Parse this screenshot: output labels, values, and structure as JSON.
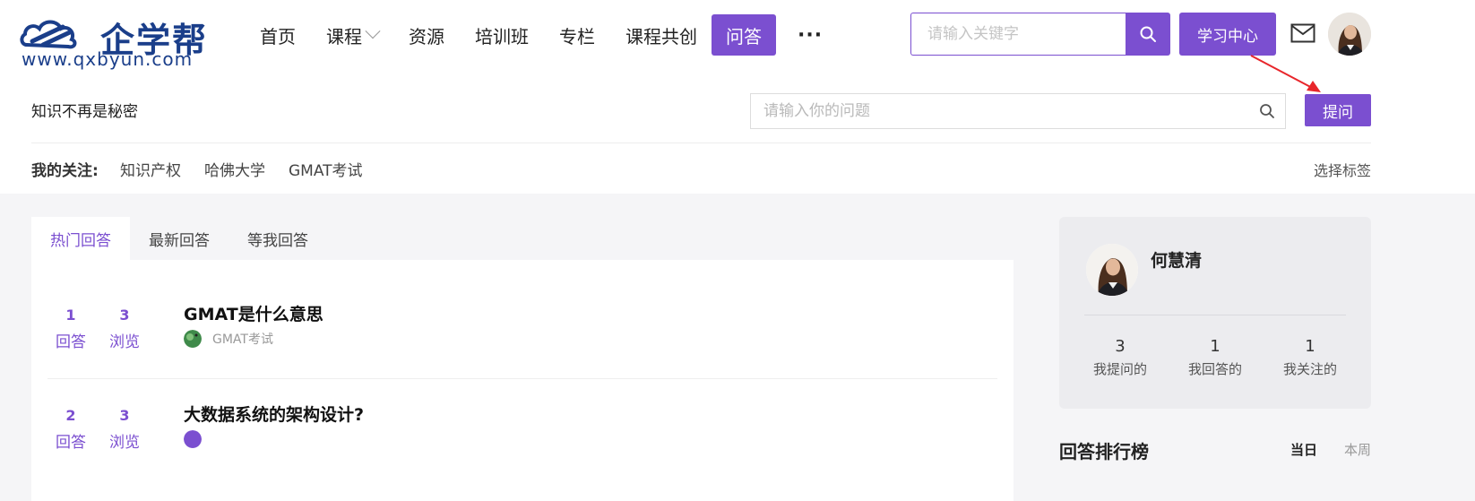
{
  "logo": {
    "brand": "企学帮",
    "url": "www.qxbyun.com"
  },
  "nav": {
    "items": [
      {
        "label": "首页"
      },
      {
        "label": "课程"
      },
      {
        "label": "资源"
      },
      {
        "label": "培训班"
      },
      {
        "label": "专栏"
      },
      {
        "label": "课程共创"
      },
      {
        "label": "问答"
      }
    ],
    "more": "···"
  },
  "top_search": {
    "placeholder": "请输入关键字"
  },
  "learn_center": "学习中心",
  "subbar": {
    "slogan": "知识不再是秘密",
    "question_placeholder": "请输入你的问题",
    "ask_button": "提问",
    "follow_label": "我的关注:",
    "follow_tags": [
      "知识产权",
      "哈佛大学",
      "GMAT考试"
    ],
    "choose_tag": "选择标签"
  },
  "tabs": [
    "热门回答",
    "最新回答",
    "等我回答"
  ],
  "questions": [
    {
      "answers": "1",
      "answers_label": "回答",
      "views": "3",
      "views_label": "浏览",
      "title": "GMAT是什么意思",
      "tag": "GMAT考试"
    },
    {
      "answers": "2",
      "answers_label": "回答",
      "views": "3",
      "views_label": "浏览",
      "title": "大数据系统的架构设计?",
      "tag": ""
    }
  ],
  "profile": {
    "name": "何慧清",
    "stats": [
      {
        "count": "3",
        "label": "我提问的"
      },
      {
        "count": "1",
        "label": "我回答的"
      },
      {
        "count": "1",
        "label": "我关注的"
      }
    ]
  },
  "ranking": {
    "title": "回答排行榜",
    "tabs": [
      "当日",
      "本周"
    ]
  },
  "colors": {
    "accent": "#7b4fd0",
    "logo": "#1a3e8a",
    "annotation_arrow": "#e8262b"
  }
}
